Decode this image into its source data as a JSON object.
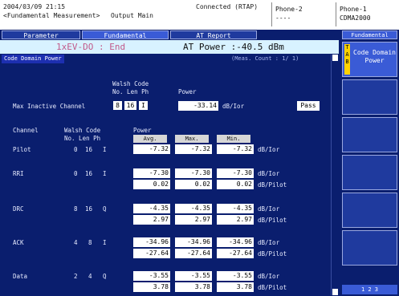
{
  "top": {
    "datetime": "2004/03/09 21:15",
    "mode": "<Fundamental Measurement>",
    "output": "Output Main",
    "connection": "Connected (RTAP)",
    "phone2_label": "Phone-2",
    "phone2_value": "----",
    "phone1_label": "Phone-1",
    "phone1_value": "CDMA2000"
  },
  "tabs": [
    "Parameter",
    "Fundamental",
    "AT Report"
  ],
  "status": {
    "end_text": "1xEV-DO : End",
    "at_power_text": "AT Power :-40.5 dBm"
  },
  "panel": {
    "title": "Code Domain Power",
    "meas_count": "(Meas. Count :      1/     1)"
  },
  "max_inactive": {
    "walsh_code_header": "Walsh Code",
    "sub_header": "No. Len Ph",
    "power_header": "Power",
    "label": "Max Inactive Channel",
    "no": "8",
    "len": "16",
    "ph": "I",
    "power": "-33.14",
    "unit": "dB/Ior",
    "result": "Pass"
  },
  "channels_header": {
    "channel": "Channel",
    "walsh_code": "Walsh Code",
    "sub": "No. Len Ph",
    "power": "Power",
    "avg": "Avg.",
    "max": "Max.",
    "min": "Min."
  },
  "channels": [
    {
      "name": "Pilot",
      "no": "0",
      "len": "16",
      "ph": "I",
      "rows": [
        {
          "avg": "-7.32",
          "max": "-7.32",
          "min": "-7.32",
          "unit": "dB/Ior"
        }
      ]
    },
    {
      "name": "RRI",
      "no": "0",
      "len": "16",
      "ph": "I",
      "rows": [
        {
          "avg": "-7.30",
          "max": "-7.30",
          "min": "-7.30",
          "unit": "dB/Ior"
        },
        {
          "avg": "0.02",
          "max": "0.02",
          "min": "0.02",
          "unit": "dB/Pilot"
        }
      ]
    },
    {
      "name": "DRC",
      "no": "8",
      "len": "16",
      "ph": "Q",
      "rows": [
        {
          "avg": "-4.35",
          "max": "-4.35",
          "min": "-4.35",
          "unit": "dB/Ior"
        },
        {
          "avg": "2.97",
          "max": "2.97",
          "min": "2.97",
          "unit": "dB/Pilot"
        }
      ]
    },
    {
      "name": "ACK",
      "no": "4",
      "len": "8",
      "ph": "I",
      "rows": [
        {
          "avg": "-34.96",
          "max": "-34.96",
          "min": "-34.96",
          "unit": "dB/Ior"
        },
        {
          "avg": "-27.64",
          "max": "-27.64",
          "min": "-27.64",
          "unit": "dB/Pilot"
        }
      ]
    },
    {
      "name": "Data",
      "no": "2",
      "len": "4",
      "ph": "Q",
      "rows": [
        {
          "avg": "-3.55",
          "max": "-3.55",
          "min": "-3.55",
          "unit": "dB/Ior"
        },
        {
          "avg": "3.78",
          "max": "3.78",
          "min": "3.78",
          "unit": "dB/Pilot"
        }
      ]
    }
  ],
  "right": {
    "header": "Fundamental",
    "button1_prefix": "T\nA\nB",
    "button1_label": "Code Domain Power",
    "page_indicator": "1 2 3"
  },
  "colors": {
    "background": "#0a1e6e",
    "accent": "#3a5bd6",
    "status_bg": "#d8f2ff",
    "end_text": "#c25a8a"
  }
}
